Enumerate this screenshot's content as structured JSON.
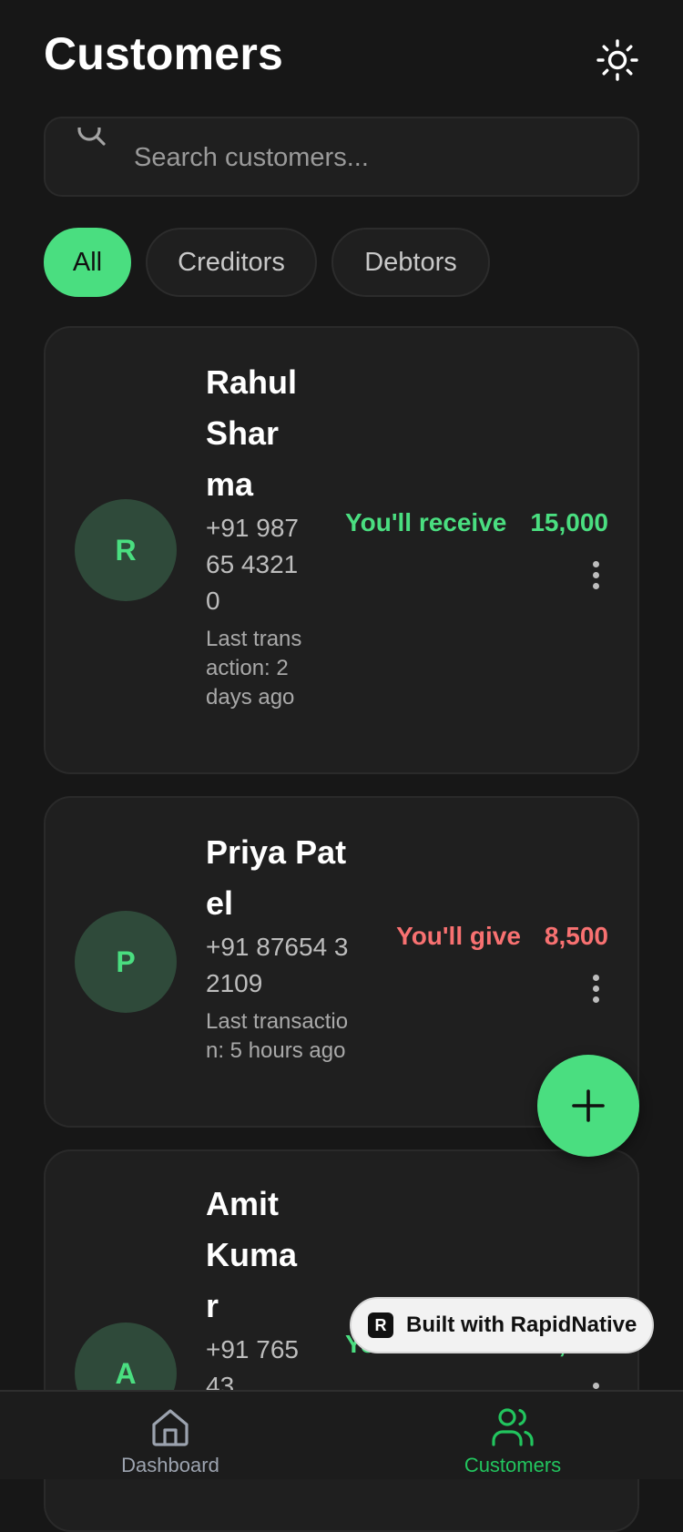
{
  "header": {
    "title": "Customers",
    "theme_icon": "sun-icon"
  },
  "search": {
    "placeholder": "Search customers...",
    "value": ""
  },
  "filters": [
    {
      "label": "All",
      "active": true
    },
    {
      "label": "Creditors",
      "active": false
    },
    {
      "label": "Debtors",
      "active": false
    }
  ],
  "customers": [
    {
      "initial": "R",
      "name": "Rahul Sharma",
      "phone": "+91 98765 43210",
      "last_transaction": "Last transaction: 2 days ago",
      "direction": "You'll receive",
      "amount": "15,000",
      "status_color": "#4ade80"
    },
    {
      "initial": "P",
      "name": "Priya Patel",
      "phone": "+91 87654 32109",
      "last_transaction": "Last transaction: 5 hours ago",
      "direction": "You'll give",
      "amount": "8,500",
      "status_color": "#f87171"
    },
    {
      "initial": "A",
      "name": "Amit Kumar",
      "phone": "+91 76543",
      "direction": "You'll receive",
      "amount": "32,000",
      "status_color": "#4ade80"
    }
  ],
  "fab": {
    "icon": "plus-icon"
  },
  "badge": {
    "label": "Built with RapidNative",
    "logo_letter": "R"
  },
  "tabs": [
    {
      "label": "Dashboard",
      "icon": "home-icon",
      "active": false
    },
    {
      "label": "Customers",
      "icon": "users-icon",
      "active": true
    }
  ],
  "colors": {
    "accent": "#4ade80",
    "negative": "#f87171",
    "background": "#171717",
    "card": "#1f1f1f",
    "inactive_tab": "#9ca3af",
    "active_tab": "#22c55e"
  }
}
